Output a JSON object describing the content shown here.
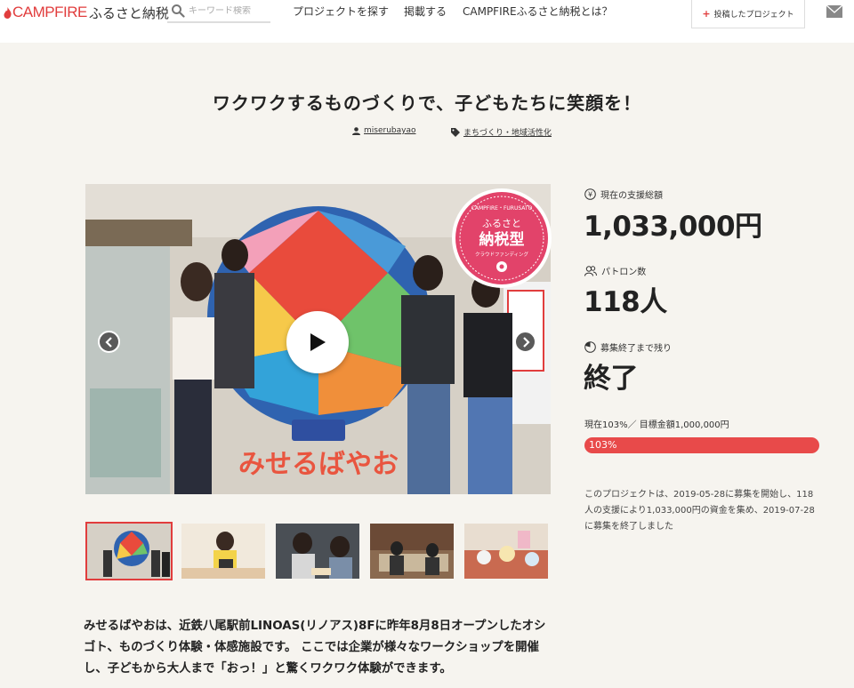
{
  "header": {
    "brand": "CAMPFIRE",
    "brand_sub": "ふるさと納税",
    "search_placeholder": "キーワード検索",
    "nav": [
      "プロジェクトを探す",
      "掲載する",
      "CAMPFIREふるさと納税とは？"
    ],
    "posted_projects": "投稿したプロジェクト"
  },
  "project": {
    "title": "ワクワクするものづくりで、子どもたちに笑顔を！",
    "owner": "miserubayao",
    "category": "まちづくり・地域活性化"
  },
  "badge": {
    "top_text": "CAMPFIRE・FURUSATO",
    "line1": "ふるさと",
    "line2": "納税型",
    "line3": "クラウドファンディング"
  },
  "hero_sign": "みせるばやお",
  "stats": {
    "amount_label": "現在の支援総額",
    "amount_value": "1,033,000円",
    "backers_label": "パトロン数",
    "backers_value": "118人",
    "remaining_label": "募集終了まで残り",
    "remaining_value": "終了",
    "goal_line": "現在103%／ 目標金額1,000,000円",
    "progress_label": "103%",
    "progress_fraction": 1.03
  },
  "summary": "このプロジェクトは、2019-05-28に募集を開始し、118人の支援により1,033,000円の資金を集め、2019-07-28に募集を終了しました",
  "description": "みせるばやおは、近鉄八尾駅前LINOAS(リノアス)8Fに昨年8月8日オープンしたオシゴト、ものづくり体験・体感施設です。 ここでは企業が様々なワークショップを開催し、子どもから大人まで「おっ！」と驚くワクワク体験ができます。",
  "colors": {
    "accent": "#e13d3d",
    "progress": "#e84a4a",
    "background": "#f6f4ef"
  }
}
